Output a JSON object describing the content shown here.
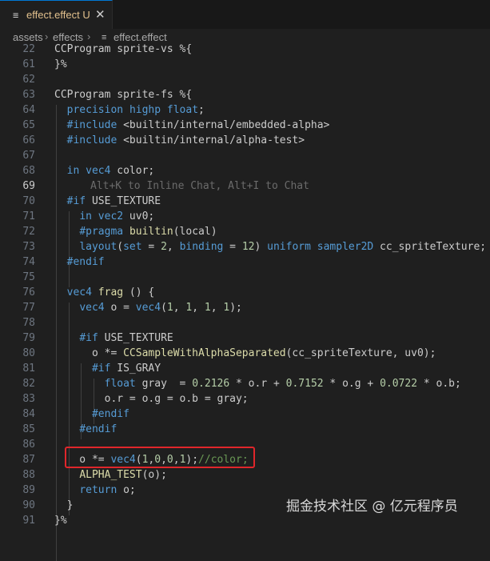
{
  "tab": {
    "icon": "lines-icon",
    "title": "effect.effect U",
    "close": "✕"
  },
  "breadcrumb": {
    "items": [
      "assets",
      "effects",
      "effect.effect"
    ],
    "separator": "›",
    "file_icon": "lines-icon"
  },
  "editor": {
    "active_line": 69,
    "lines": [
      {
        "n": "22",
        "code": "CCProgram sprite-vs %{"
      },
      {
        "n": "61",
        "code": "}%"
      },
      {
        "n": "62",
        "code": ""
      },
      {
        "n": "63",
        "code": "CCProgram sprite-fs %{"
      },
      {
        "n": "64",
        "code": "  precision highp float;"
      },
      {
        "n": "65",
        "code": "  #include <builtin/internal/embedded-alpha>"
      },
      {
        "n": "66",
        "code": "  #include <builtin/internal/alpha-test>"
      },
      {
        "n": "67",
        "code": ""
      },
      {
        "n": "68",
        "code": "  in vec4 color;"
      },
      {
        "n": "69",
        "code": ""
      },
      {
        "n": "70",
        "code": "  #if USE_TEXTURE"
      },
      {
        "n": "71",
        "code": "    in vec2 uv0;"
      },
      {
        "n": "72",
        "code": "    #pragma builtin(local)"
      },
      {
        "n": "73",
        "code": "    layout(set = 2, binding = 12) uniform sampler2D cc_spriteTexture;"
      },
      {
        "n": "74",
        "code": "  #endif"
      },
      {
        "n": "75",
        "code": ""
      },
      {
        "n": "76",
        "code": "  vec4 frag () {"
      },
      {
        "n": "77",
        "code": "    vec4 o = vec4(1, 1, 1, 1);"
      },
      {
        "n": "78",
        "code": ""
      },
      {
        "n": "79",
        "code": "    #if USE_TEXTURE"
      },
      {
        "n": "80",
        "code": "      o *= CCSampleWithAlphaSeparated(cc_spriteTexture, uv0);"
      },
      {
        "n": "81",
        "code": "      #if IS_GRAY"
      },
      {
        "n": "82",
        "code": "        float gray  = 0.2126 * o.r + 0.7152 * o.g + 0.0722 * o.b;"
      },
      {
        "n": "83",
        "code": "        o.r = o.g = o.b = gray;"
      },
      {
        "n": "84",
        "code": "      #endif"
      },
      {
        "n": "85",
        "code": "    #endif"
      },
      {
        "n": "86",
        "code": ""
      },
      {
        "n": "87",
        "code": "    o *= vec4(1,0,0,1);//color;"
      },
      {
        "n": "88",
        "code": "    ALPHA_TEST(o);"
      },
      {
        "n": "89",
        "code": "    return o;"
      },
      {
        "n": "90",
        "code": "  }"
      },
      {
        "n": "91",
        "code": "}%"
      }
    ],
    "ghost_hint": "Alt+K to Inline Chat, Alt+I to Chat"
  },
  "watermark": "掘金技术社区 @ 亿元程序员",
  "colors": {
    "keyword": "#569cd6",
    "function": "#dcdcaa",
    "number": "#b5cea8",
    "comment": "#6a9955",
    "highlight_box": "#e0262b",
    "modified_tab": "#e2c08d"
  }
}
